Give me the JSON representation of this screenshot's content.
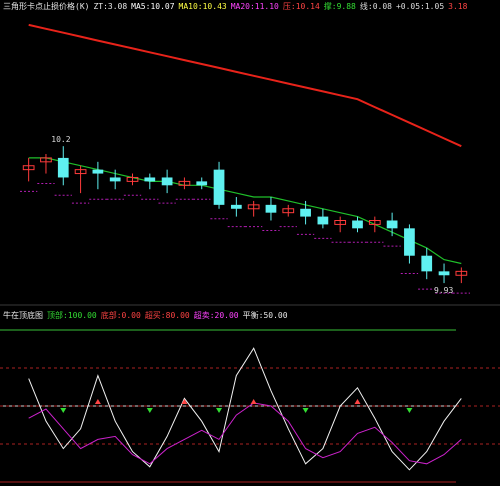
{
  "colors": {
    "background": "#000000",
    "up_candle": "#ff3b3b",
    "down_candle": "#5ff0f0",
    "long_ma": "#e8231a",
    "mid_ma": "#1fbf2a",
    "short_line": "#22b3a5",
    "dots": "#b31db3",
    "sub_white": "#f2f2f2",
    "sub_magenta": "#cc22cc",
    "sub_green": "#39c039",
    "sub_grid_red": "#aa2222",
    "marker_red": "#ff4444",
    "marker_green": "#33dd33",
    "marker_cyan": "#44aaff"
  },
  "main_panel": {
    "legend": [
      {
        "text": "三角形卡点止损价格(K)",
        "color": "#e8e8e8"
      },
      {
        "text": "ZT:3.08",
        "color": "#e8e8e8"
      },
      {
        "text": "MA5:10.07",
        "color": "#ffffff"
      },
      {
        "text": "MA10:10.43",
        "color": "#ffff44"
      },
      {
        "text": "MA20:11.10",
        "color": "#ff44ff"
      },
      {
        "text": "压:10.14",
        "color": "#ff4444"
      },
      {
        "text": "撑:9.88",
        "color": "#33dd33"
      },
      {
        "text": "线:0.08",
        "color": "#dddddd"
      },
      {
        "text": "+0.05:1.05",
        "color": "#dddddd"
      },
      {
        "text": "3.18",
        "color": "#ff4444"
      }
    ],
    "high_label": "10.2",
    "low_label": "9.93"
  },
  "chart_data": [
    {
      "type": "candlestick",
      "candles": [
        {
          "o": 10.02,
          "h": 10.05,
          "c": 10.03,
          "l": 9.99
        },
        {
          "o": 10.04,
          "h": 10.06,
          "c": 10.05,
          "l": 10.01
        },
        {
          "o": 10.05,
          "h": 10.08,
          "c": 10.0,
          "l": 9.98
        },
        {
          "o": 10.01,
          "h": 10.03,
          "c": 10.02,
          "l": 9.96
        },
        {
          "o": 10.02,
          "h": 10.04,
          "c": 10.01,
          "l": 9.97
        },
        {
          "o": 10.0,
          "h": 10.02,
          "c": 9.99,
          "l": 9.97
        },
        {
          "o": 9.99,
          "h": 10.01,
          "c": 10.0,
          "l": 9.98
        },
        {
          "o": 10.0,
          "h": 10.01,
          "c": 9.99,
          "l": 9.97
        },
        {
          "o": 10.0,
          "h": 10.02,
          "c": 9.98,
          "l": 9.96
        },
        {
          "o": 9.98,
          "h": 10.0,
          "c": 9.99,
          "l": 9.97
        },
        {
          "o": 9.99,
          "h": 10.0,
          "c": 9.98,
          "l": 9.97
        },
        {
          "o": 10.02,
          "h": 10.04,
          "c": 9.93,
          "l": 9.92
        },
        {
          "o": 9.93,
          "h": 9.95,
          "c": 9.92,
          "l": 9.9
        },
        {
          "o": 9.92,
          "h": 9.94,
          "c": 9.93,
          "l": 9.9
        },
        {
          "o": 9.93,
          "h": 9.95,
          "c": 9.91,
          "l": 9.89
        },
        {
          "o": 9.91,
          "h": 9.93,
          "c": 9.92,
          "l": 9.9
        },
        {
          "o": 9.92,
          "h": 9.94,
          "c": 9.9,
          "l": 9.88
        },
        {
          "o": 9.9,
          "h": 9.92,
          "c": 9.88,
          "l": 9.87
        },
        {
          "o": 9.88,
          "h": 9.9,
          "c": 9.89,
          "l": 9.86
        },
        {
          "o": 9.89,
          "h": 9.9,
          "c": 9.87,
          "l": 9.86
        },
        {
          "o": 9.88,
          "h": 9.9,
          "c": 9.89,
          "l": 9.86
        },
        {
          "o": 9.89,
          "h": 9.91,
          "c": 9.87,
          "l": 9.85
        },
        {
          "o": 9.87,
          "h": 9.88,
          "c": 9.8,
          "l": 9.78
        },
        {
          "o": 9.8,
          "h": 9.82,
          "c": 9.76,
          "l": 9.74
        },
        {
          "o": 9.76,
          "h": 9.78,
          "c": 9.75,
          "l": 9.73
        },
        {
          "o": 9.75,
          "h": 9.77,
          "c": 9.76,
          "l": 9.73
        }
      ],
      "long_ma": [
        10.39,
        10.38,
        10.37,
        10.36,
        10.35,
        10.34,
        10.33,
        10.32,
        10.31,
        10.3,
        10.29,
        10.28,
        10.27,
        10.26,
        10.25,
        10.24,
        10.23,
        10.22,
        10.21,
        10.2,
        10.18,
        10.16,
        10.14,
        10.12,
        10.1,
        10.08
      ],
      "mid_ma": [
        10.05,
        10.05,
        10.04,
        10.03,
        10.02,
        10.01,
        10.0,
        9.99,
        9.99,
        9.98,
        9.98,
        9.97,
        9.96,
        9.95,
        9.95,
        9.94,
        9.93,
        9.92,
        9.91,
        9.9,
        9.88,
        9.86,
        9.84,
        9.82,
        9.79,
        9.78
      ]
    },
    {
      "type": "line",
      "series": [
        {
          "values": [
            68,
            40,
            22,
            35,
            70,
            40,
            20,
            10,
            30,
            55,
            40,
            20,
            70,
            88,
            60,
            35,
            12,
            22,
            50,
            62,
            42,
            20,
            8,
            20,
            40,
            55
          ]
        },
        {
          "values": [
            42,
            48,
            35,
            22,
            28,
            30,
            18,
            12,
            22,
            28,
            34,
            28,
            44,
            52,
            50,
            40,
            22,
            16,
            20,
            32,
            36,
            26,
            14,
            12,
            18,
            28
          ]
        }
      ],
      "ylim": [
        0,
        100
      ],
      "ref_lines": [
        100,
        50,
        0
      ],
      "legend": [
        {
          "text": "牛在顶底图",
          "color": "#e8e8e8"
        },
        {
          "text": "顶部:100.00",
          "color": "#33dd33"
        },
        {
          "text": "底部:0.00",
          "color": "#ff4444"
        },
        {
          "text": "超买:80.00",
          "color": "#ff4444"
        },
        {
          "text": "超卖:20.00",
          "color": "#ff44ff"
        },
        {
          "text": "平衡:50.00",
          "color": "#e8e8e8"
        }
      ]
    }
  ]
}
